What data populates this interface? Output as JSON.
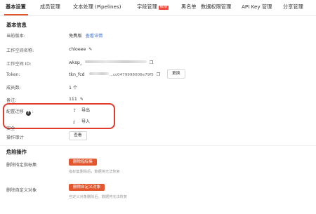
{
  "tabs": [
    {
      "label": "基本设置",
      "active": true
    },
    {
      "label": "成员管理"
    },
    {
      "label": "文本处理 (Pipelines)"
    },
    {
      "label": "字段管理",
      "badge": "NEW"
    },
    {
      "label": "黑名单"
    },
    {
      "label": "数据权限管理"
    },
    {
      "label": "API Key 管理"
    },
    {
      "label": "分享管理"
    }
  ],
  "basic": {
    "title": "基本信息",
    "version_label": "当前版本:",
    "version_value": "免费版",
    "version_link": "查看详情",
    "name_label": "工作空间名称:",
    "name_value": "chloeee",
    "id_label": "工作空间 ID:",
    "id_value_start": "wksp_",
    "token_label": "Token:",
    "token_prefix": "tkn_fcd",
    "token_suffix": "...cc0479998006e79f5",
    "token_button": "更换",
    "members_label": "成员数:",
    "members_value": "1 个",
    "remark_label": "备注:",
    "remark_value": "111",
    "migrate_label": "配置迁移",
    "migrate_export": "导出",
    "migrate_import": "导入",
    "audit_label": "操作审计",
    "audit_label_overlap": "安全",
    "audit_button": "查看"
  },
  "danger": {
    "title": "危险操作",
    "delete_metric_label": "删除指定指标集",
    "delete_metric_button": "删除指标集",
    "delete_metric_hint": "指标集删除后，数据将无法恢复",
    "delete_custom_label": "删除自定义对象",
    "delete_custom_button": "删除自定义对象",
    "delete_custom_hint": "自定义对象删除后，数据将无法恢复"
  },
  "colors": {
    "accent": "#e4572e",
    "highlight": "#e23b2c",
    "link": "#3b73d9"
  }
}
